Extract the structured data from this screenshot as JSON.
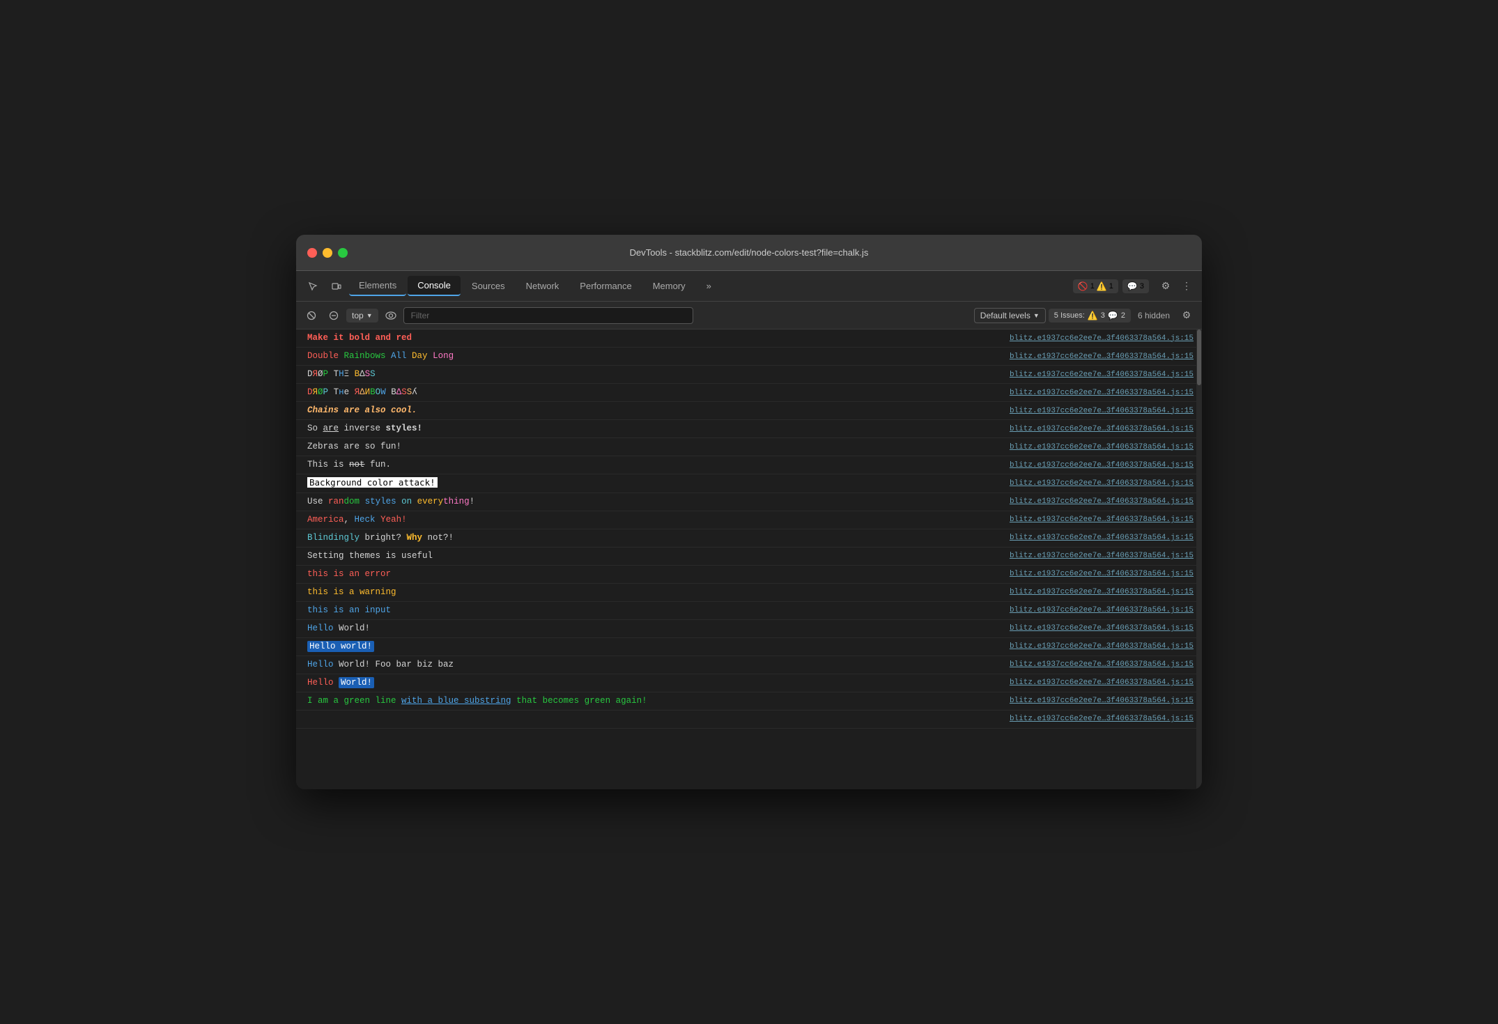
{
  "window": {
    "title": "DevTools - stackblitz.com/edit/node-colors-test?file=chalk.js"
  },
  "tabs": {
    "items": [
      {
        "label": "Elements",
        "active": false
      },
      {
        "label": "Console",
        "active": true
      },
      {
        "label": "Sources",
        "active": false
      },
      {
        "label": "Network",
        "active": false
      },
      {
        "label": "Performance",
        "active": false
      },
      {
        "label": "Memory",
        "active": false
      }
    ],
    "more_label": "»"
  },
  "badges": {
    "errors": "1",
    "warnings": "1",
    "info": "3"
  },
  "toolbar": {
    "top_label": "top",
    "filter_placeholder": "Filter",
    "levels_label": "Default levels",
    "issues_label": "5 Issues:",
    "issues_warn": "3",
    "issues_msg": "2",
    "hidden_label": "6 hidden"
  },
  "console_rows": [
    {
      "id": 1,
      "src": "blitz.e1937cc6e2ee7e…3f4063378a564.js:15"
    },
    {
      "id": 2,
      "src": "blitz.e1937cc6e2ee7e…3f4063378a564.js:15"
    },
    {
      "id": 3,
      "src": "blitz.e1937cc6e2ee7e…3f4063378a564.js:15"
    },
    {
      "id": 4,
      "src": "blitz.e1937cc6e2ee7e…3f4063378a564.js:15"
    },
    {
      "id": 5,
      "src": "blitz.e1937cc6e2ee7e…3f4063378a564.js:15"
    },
    {
      "id": 6,
      "src": "blitz.e1937cc6e2ee7e…3f4063378a564.js:15"
    },
    {
      "id": 7,
      "src": "blitz.e1937cc6e2ee7e…3f4063378a564.js:15"
    },
    {
      "id": 8,
      "src": "blitz.e1937cc6e2ee7e…3f4063378a564.js:15"
    },
    {
      "id": 9,
      "src": "blitz.e1937cc6e2ee7e…3f4063378a564.js:15"
    },
    {
      "id": 10,
      "src": "blitz.e1937cc6e2ee7e…3f4063378a564.js:15"
    },
    {
      "id": 11,
      "src": "blitz.e1937cc6e2ee7e…3f4063378a564.js:15"
    },
    {
      "id": 12,
      "src": "blitz.e1937cc6e2ee7e…3f4063378a564.js:15"
    },
    {
      "id": 13,
      "src": "blitz.e1937cc6e2ee7e…3f4063378a564.js:15"
    },
    {
      "id": 14,
      "src": "blitz.e1937cc6e2ee7e…3f4063378a564.js:15"
    },
    {
      "id": 15,
      "src": "blitz.e1937cc6e2ee7e…3f4063378a564.js:15"
    },
    {
      "id": 16,
      "src": "blitz.e1937cc6e2ee7e…3f4063378a564.js:15"
    },
    {
      "id": 17,
      "src": "blitz.e1937cc6e2ee7e…3f4063378a564.js:15"
    },
    {
      "id": 18,
      "src": "blitz.e1937cc6e2ee7e…3f4063378a564.js:15"
    },
    {
      "id": 19,
      "src": "blitz.e1937cc6e2ee7e…3f4063378a564.js:15"
    },
    {
      "id": 20,
      "src": "blitz.e1937cc6e2ee7e…3f4063378a564.js:15"
    },
    {
      "id": 21,
      "src": "blitz.e1937cc6e2ee7e…3f4063378a564.js:15"
    },
    {
      "id": 22,
      "src": "blitz.e1937cc6e2ee7e…3f4063378a564.js:15"
    },
    {
      "id": 23,
      "src": "blitz.e1937cc6e2ee7e…3f4063378a564.js:15"
    },
    {
      "id": 24,
      "src": "blitz.e1937cc6e2ee7e…3f4063378a564.js:15"
    }
  ]
}
